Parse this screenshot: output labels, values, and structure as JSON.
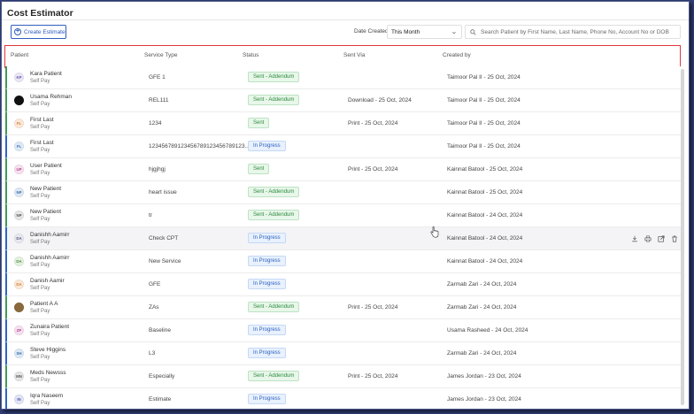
{
  "page": {
    "title": "Cost Estimator"
  },
  "toolbar": {
    "create_label": "Create Estimate",
    "date_label": "Date Created",
    "date_value": "This Month",
    "search_placeholder": "Search Patient by First Name, Last Name, Phone No, Account No or DOB"
  },
  "table": {
    "columns": [
      "Patient",
      "Service Type",
      "Status",
      "Sent Via",
      "Created by"
    ],
    "rows": [
      {
        "initials": "KP",
        "avatar_bg": "#ece7f7",
        "avatar_fg": "#6b52a8",
        "name": "Kara Patient",
        "pay": "Self Pay",
        "service": "GFE 1",
        "status": "Sent - Addendum",
        "status_color": "green",
        "sent_via": "",
        "created_by": "Taimoor Pal II - 25 Oct, 2024",
        "bar": "green"
      },
      {
        "initials": "",
        "avatar_bg": "#111111",
        "avatar_fg": "#111111",
        "name": "Usama Rehman",
        "pay": "Self Pay",
        "service": "REL111",
        "status": "Sent - Addendum",
        "status_color": "green",
        "sent_via": "Download - 25 Oct, 2024",
        "created_by": "Taimoor Pal II - 25 Oct, 2024",
        "bar": "green"
      },
      {
        "initials": "FL",
        "avatar_bg": "#fde9d9",
        "avatar_fg": "#d07a2d",
        "name": "First Last",
        "pay": "Self Pay",
        "service": "1234",
        "status": "Sent",
        "status_color": "green",
        "sent_via": "Print - 25 Oct, 2024",
        "created_by": "Taimoor Pal II - 25 Oct, 2024",
        "bar": "green"
      },
      {
        "initials": "FL",
        "avatar_bg": "#dfeaf7",
        "avatar_fg": "#3f70b8",
        "name": "First Last",
        "pay": "Self Pay",
        "service": "123456789123456789123456789123...",
        "status": "In Progress",
        "status_color": "blue",
        "sent_via": "",
        "created_by": "Taimoor Pal II - 25 Oct, 2024",
        "bar": "blue"
      },
      {
        "initials": "UP",
        "avatar_bg": "#f8e1f0",
        "avatar_fg": "#b0468c",
        "name": "User Patient",
        "pay": "Self Pay",
        "service": "hjgjhgj",
        "status": "Sent",
        "status_color": "green",
        "sent_via": "Print - 25 Oct, 2024",
        "created_by": "Kainnat Batool - 25 Oct, 2024",
        "bar": "green"
      },
      {
        "initials": "NP",
        "avatar_bg": "#dde9f6",
        "avatar_fg": "#3c6aa8",
        "name": "New Patient",
        "pay": "Self Pay",
        "service": "heart issue",
        "status": "Sent - Addendum",
        "status_color": "green",
        "sent_via": "",
        "created_by": "Kainnat Batool - 25 Oct, 2024",
        "bar": "green"
      },
      {
        "initials": "NP",
        "avatar_bg": "#e6e6e6",
        "avatar_fg": "#555555",
        "name": "New Patient",
        "pay": "Self Pay",
        "service": "tr",
        "status": "Sent - Addendum",
        "status_color": "green",
        "sent_via": "",
        "created_by": "Kainnat Batool - 24 Oct, 2024",
        "bar": "green"
      },
      {
        "initials": "DA",
        "avatar_bg": "#e8e8f0",
        "avatar_fg": "#5a5a7a",
        "name": "Danishh Aamirr",
        "pay": "Self Pay",
        "service": "Check CPT",
        "status": "In Progress",
        "status_color": "blue",
        "sent_via": "",
        "created_by": "Kainnat Batool - 24 Oct, 2024",
        "bar": "blue",
        "hover": true
      },
      {
        "initials": "DA",
        "avatar_bg": "#e4f2df",
        "avatar_fg": "#4b8a3c",
        "name": "Danishh Aamirr",
        "pay": "Self Pay",
        "service": "New Service",
        "status": "In Progress",
        "status_color": "blue",
        "sent_via": "",
        "created_by": "Kainnat Batool - 24 Oct, 2024",
        "bar": "blue"
      },
      {
        "initials": "DA",
        "avatar_bg": "#fde9d9",
        "avatar_fg": "#d07a2d",
        "name": "Danish Aamir",
        "pay": "Self Pay",
        "service": "GFE",
        "status": "In Progress",
        "status_color": "blue",
        "sent_via": "",
        "created_by": "Zarmab Zari - 24 Oct, 2024",
        "bar": "blue"
      },
      {
        "initials": "",
        "avatar_bg": "#8a6a3c",
        "avatar_fg": "#8a6a3c",
        "name": "Patient A A",
        "pay": "Self Pay",
        "service": "ZAs",
        "status": "Sent - Addendum",
        "status_color": "green",
        "sent_via": "Print - 25 Oct, 2024",
        "created_by": "Zarmab Zari - 24 Oct, 2024",
        "bar": "green"
      },
      {
        "initials": "ZP",
        "avatar_bg": "#f7e0f0",
        "avatar_fg": "#b0468c",
        "name": "Zunaira Patient",
        "pay": "Self Pay",
        "service": "Baseline",
        "status": "In Progress",
        "status_color": "blue",
        "sent_via": "",
        "created_by": "Usama Rasheed - 24 Oct, 2024",
        "bar": "blue"
      },
      {
        "initials": "SH",
        "avatar_bg": "#dde9f6",
        "avatar_fg": "#3c6aa8",
        "name": "Steve Higgins",
        "pay": "Self Pay",
        "service": "L3",
        "status": "In Progress",
        "status_color": "blue",
        "sent_via": "",
        "created_by": "Zarmab Zari - 24 Oct, 2024",
        "bar": "blue"
      },
      {
        "initials": "MN",
        "avatar_bg": "#e6e6e6",
        "avatar_fg": "#555555",
        "name": "Meds Newsss",
        "pay": "Self Pay",
        "service": "Especially",
        "status": "Sent - Addendum",
        "status_color": "green",
        "sent_via": "Print - 25 Oct, 2024",
        "created_by": "James Jordan - 23 Oct, 2024",
        "bar": "green"
      },
      {
        "initials": "IN",
        "avatar_bg": "#e3e5f7",
        "avatar_fg": "#4a55a8",
        "name": "Iqra Naseem",
        "pay": "Self Pay",
        "service": "Estimate",
        "status": "In Progress",
        "status_color": "blue",
        "sent_via": "",
        "created_by": "James Jordan - 23 Oct, 2024",
        "bar": "blue"
      }
    ],
    "row_actions": [
      "download-icon",
      "print-icon",
      "share-icon",
      "trash-icon"
    ]
  },
  "colors": {
    "accent": "#2a5bbf",
    "highlight_border": "#e0373d",
    "status_green": "#2c8a3c",
    "status_blue": "#2d5fbf"
  }
}
